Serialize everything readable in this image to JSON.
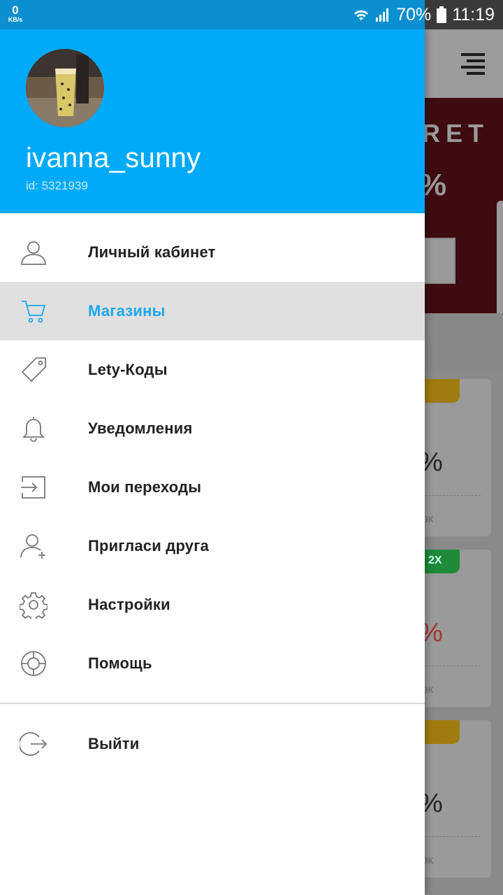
{
  "status_bar": {
    "net_speed_value": "0",
    "net_speed_unit": "KB/s",
    "battery": "70%",
    "time": "11:19",
    "icons": [
      "wifi-icon",
      "signal-icon",
      "battery-icon"
    ]
  },
  "drawer": {
    "header_color": "#00aaf8",
    "username": "ivanna_sunny",
    "user_id": "id: 5321939",
    "menu": [
      {
        "label": "Личный кабинет",
        "icon": "person-icon",
        "active": false
      },
      {
        "label": "Магазины",
        "icon": "cart-icon",
        "active": true
      },
      {
        "label": "Lety-Коды",
        "icon": "tag-icon",
        "active": false
      },
      {
        "label": "Уведомления",
        "icon": "bell-icon",
        "active": false
      },
      {
        "label": "Мои переходы",
        "icon": "enter-icon",
        "active": false
      },
      {
        "label": "Пригласи друга",
        "icon": "add-person-icon",
        "active": false
      },
      {
        "label": "Настройки",
        "icon": "gear-icon",
        "active": false
      },
      {
        "label": "Помощь",
        "icon": "lifebuoy-icon",
        "active": false
      }
    ],
    "logout_label": "Выйти",
    "accent_color": "#1ba8ec"
  },
  "background": {
    "banner_text": "RET",
    "banner_pct": "%",
    "cards": [
      {
        "badge": "",
        "pct": "%",
        "label": "эк"
      },
      {
        "badge": "2X",
        "pct": "%",
        "label": "эк"
      },
      {
        "badge": "",
        "pct": "%",
        "label": "эк"
      }
    ]
  }
}
